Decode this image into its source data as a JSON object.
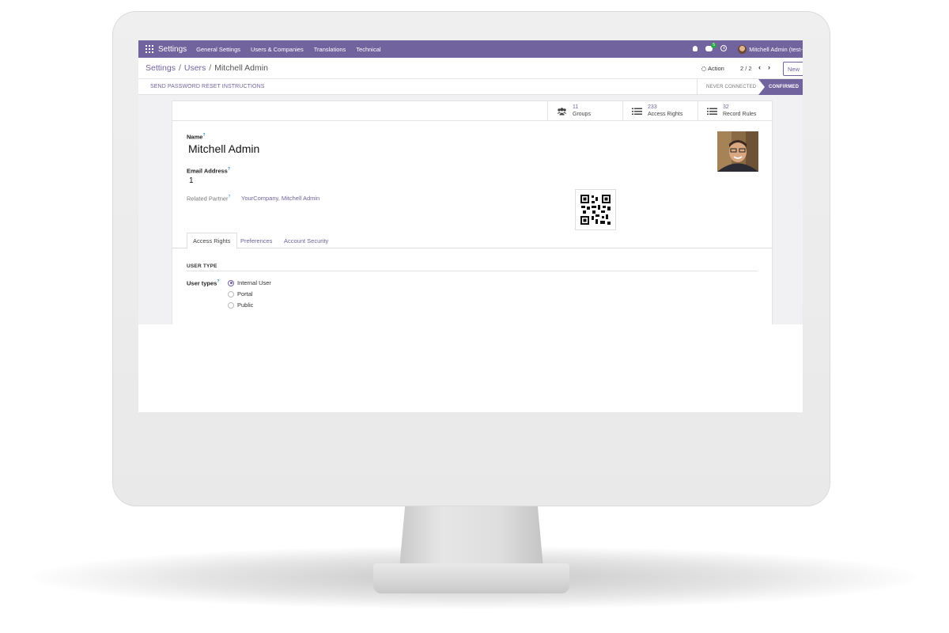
{
  "navbar": {
    "brand": "Settings",
    "menu": [
      "General Settings",
      "Users & Companies",
      "Translations",
      "Technical"
    ],
    "messages_count": "5",
    "user": "Mitchell Admin (test-d"
  },
  "control_panel": {
    "breadcrumb": [
      "Settings",
      "Users",
      "Mitchell Admin"
    ],
    "action_label": "Action",
    "pager": "2 / 2",
    "prev": "‹",
    "next": "›",
    "new_label": "New"
  },
  "status_bar": {
    "reset_button": "SEND PASSWORD RESET INSTRUCTIONS",
    "stages": [
      "NEVER CONNECTED",
      "CONFIRMED"
    ],
    "active_stage": "CONFIRMED"
  },
  "stat_buttons": [
    {
      "icon": "users-icon",
      "value": "11",
      "label": "Groups"
    },
    {
      "icon": "list-icon",
      "value": "233",
      "label": "Access Rights"
    },
    {
      "icon": "list-icon",
      "value": "32",
      "label": "Record Rules"
    }
  ],
  "form": {
    "name_label": "Name",
    "name_value": "Mitchell Admin",
    "email_label": "Email Address",
    "email_value": "1",
    "partner_label": "Related Partner",
    "partner_value": "YourCompany, Mitchell Admin",
    "help_mark": "?"
  },
  "tabs": [
    {
      "label": "Access Rights",
      "active": true
    },
    {
      "label": "Preferences",
      "active": false
    },
    {
      "label": "Account Security",
      "active": false
    }
  ],
  "access_rights": {
    "section_title": "USER TYPE",
    "user_types_label": "User types",
    "options": [
      "Internal User",
      "Portal",
      "Public"
    ],
    "selected": "Internal User"
  },
  "colors": {
    "brand": "#71639e",
    "badge": "#28a745"
  }
}
